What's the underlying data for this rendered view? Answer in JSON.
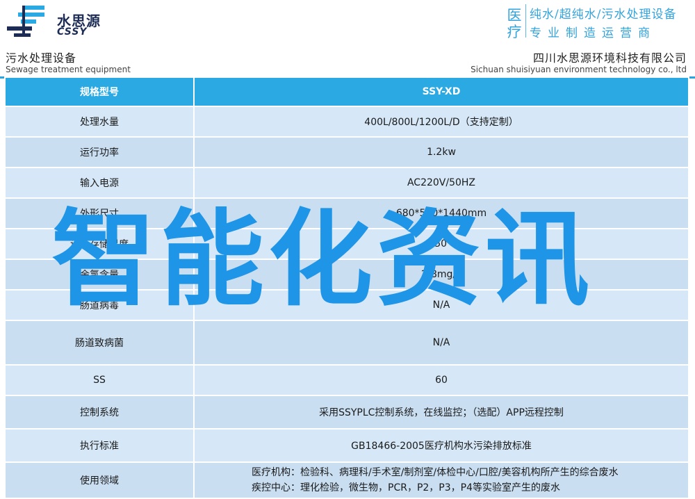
{
  "header": {
    "logo_cn": "水思源",
    "logo_en": "CSSY",
    "tag_chars": [
      "医",
      "疗"
    ],
    "tag_line1": "纯水/超纯水/污水处理设备",
    "tag_line2": "专业制造运营商"
  },
  "band": {
    "left_cn": "污水处理设备",
    "left_en": "Sewage treatment equipment",
    "right_cn": "四川水思源环境科技有限公司",
    "right_en": "Sichuan shuisiyuan environment technology co., ltd"
  },
  "table": {
    "header": {
      "label": "规格型号",
      "value": "SSY-XD"
    },
    "rows": [
      {
        "label": "处理水量",
        "value": "400L/800L/1200L/D（支持定制）"
      },
      {
        "label": "运行功率",
        "value": "1.2kw"
      },
      {
        "label": "输入电源",
        "value": "AC220V/50HZ"
      },
      {
        "label": "外形尺寸",
        "value": "680*560*1440mm"
      },
      {
        "label": "设备存储温度",
        "value": "0-50℃"
      },
      {
        "label": "余氯含量",
        "value": "2-8mg/L"
      },
      {
        "label": "肠道病毒",
        "value": "N/A"
      },
      {
        "label": "肠道致病菌",
        "value": "N/A"
      },
      {
        "label": "SS",
        "value": "60"
      },
      {
        "label": "控制系统",
        "value": "采用SSYPLC控制系统，在线监控；（选配）APP远程控制"
      },
      {
        "label": "执行标准",
        "value": "GB18466-2005医疗机构水污染排放标准"
      },
      {
        "label": "使用领域",
        "value_line1": "医疗机构：检验科、病理科/手术室/制剂室/体检中心/口腔/美容机构所产生的综合废水",
        "value_line2": "疾控中心：理化检验，微生物，PCR，P2，P3，P4等实验室产生的废水"
      }
    ]
  },
  "overlay_text": "智能化资讯",
  "colors": {
    "accent": "#2aa9e3",
    "row_bg": "#d6e8f7",
    "overlay": "#1f95e8"
  }
}
